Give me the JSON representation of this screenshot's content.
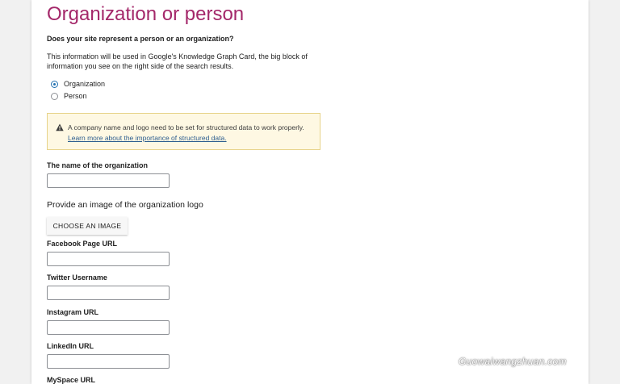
{
  "section": {
    "title": "Organization or person",
    "question": "Does your site represent a person or an organization?",
    "description": "This information will be used in Google's Knowledge Graph Card, the big block of information you see on the right side of the search results."
  },
  "radios": {
    "organization": {
      "label": "Organization",
      "checked": true
    },
    "person": {
      "label": "Person",
      "checked": false
    }
  },
  "notice": {
    "icon": "warning-icon",
    "text": "A company name and logo need to be set for structured data to work properly.",
    "link": "Learn more about the importance of structured data.",
    "colors": {
      "background": "#fef8e3",
      "border": "#e7d38a"
    }
  },
  "fields": {
    "org_name_label": "The name of the organization",
    "logo_label": "Provide an image of the organization logo",
    "choose_image_button": "CHOOSE AN IMAGE",
    "facebook_label": "Facebook Page URL",
    "twitter_label": "Twitter Username",
    "instagram_label": "Instagram URL",
    "linkedin_label": "LinkedIn URL",
    "myspace_label": "MySpace URL"
  },
  "watermark": "Guowaiwangzhuan.com",
  "colors": {
    "title": "#a4286a",
    "radio_accent": "#2271b1",
    "link": "#2c5d8f"
  }
}
